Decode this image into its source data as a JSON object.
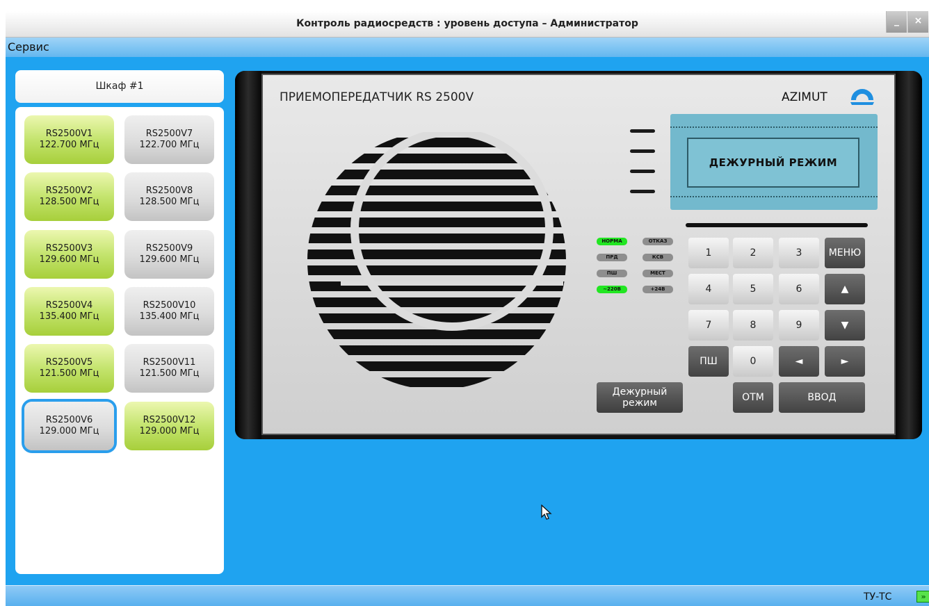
{
  "window": {
    "title": "Контроль радиосредств : уровень доступа – Администратор",
    "minimize_label": "_",
    "close_label": "×"
  },
  "menu": {
    "service_label": "Сервис"
  },
  "cabinet": {
    "header": "Шкаф #1"
  },
  "devices": [
    {
      "name": "RS2500V1",
      "freq": "122.700 МГц",
      "state": "green"
    },
    {
      "name": "RS2500V7",
      "freq": "122.700 МГц",
      "state": "gray"
    },
    {
      "name": "RS2500V2",
      "freq": "128.500 МГц",
      "state": "green"
    },
    {
      "name": "RS2500V8",
      "freq": "128.500 МГц",
      "state": "gray"
    },
    {
      "name": "RS2500V3",
      "freq": "129.600 МГц",
      "state": "green"
    },
    {
      "name": "RS2500V9",
      "freq": "129.600 МГц",
      "state": "gray"
    },
    {
      "name": "RS2500V4",
      "freq": "135.400 МГц",
      "state": "green"
    },
    {
      "name": "RS2500V10",
      "freq": "135.400 МГц",
      "state": "gray"
    },
    {
      "name": "RS2500V5",
      "freq": "121.500 МГц",
      "state": "green"
    },
    {
      "name": "RS2500V11",
      "freq": "121.500 МГц",
      "state": "gray"
    },
    {
      "name": "RS2500V6",
      "freq": "129.000 МГц",
      "state": "gray",
      "selected": true
    },
    {
      "name": "RS2500V12",
      "freq": "129.000 МГц",
      "state": "green"
    }
  ],
  "radio": {
    "model_title": "ПРИЕМОПЕРЕДАТЧИК RS 2500V",
    "brand": "AZIMUT",
    "display_text": "ДЕЖУРНЫЙ РЕЖИМ",
    "indicators": [
      {
        "label": "НОРМА",
        "on": true
      },
      {
        "label": "ОТКАЗ",
        "on": false
      },
      {
        "label": "ПРД",
        "on": false
      },
      {
        "label": "КСВ",
        "on": false
      },
      {
        "label": "ПШ",
        "on": false
      },
      {
        "label": "МЕСТ",
        "on": false
      },
      {
        "label": "~220В",
        "on": true
      },
      {
        "label": "+24В",
        "on": false
      }
    ],
    "keys": {
      "k1": "1",
      "k2": "2",
      "k3": "3",
      "menu": "МЕНЮ",
      "k4": "4",
      "k5": "5",
      "k6": "6",
      "up": "▲",
      "k7": "7",
      "k8": "8",
      "k9": "9",
      "down": "▼",
      "psh": "ПШ",
      "k0": "0",
      "left": "◄",
      "right": "►",
      "otm": "ОТМ",
      "enter": "ВВОД"
    },
    "duty_button_line1": "Дежурный",
    "duty_button_line2": "режим"
  },
  "status": {
    "text": "ТУ-ТС",
    "icon": "connection-arrow-icon",
    "icon_glyph": "»"
  },
  "colors": {
    "background": "#1fa3f0",
    "active_green": "#a7cf3b",
    "led_on": "#22e622",
    "lcd": "#73b9cd"
  }
}
